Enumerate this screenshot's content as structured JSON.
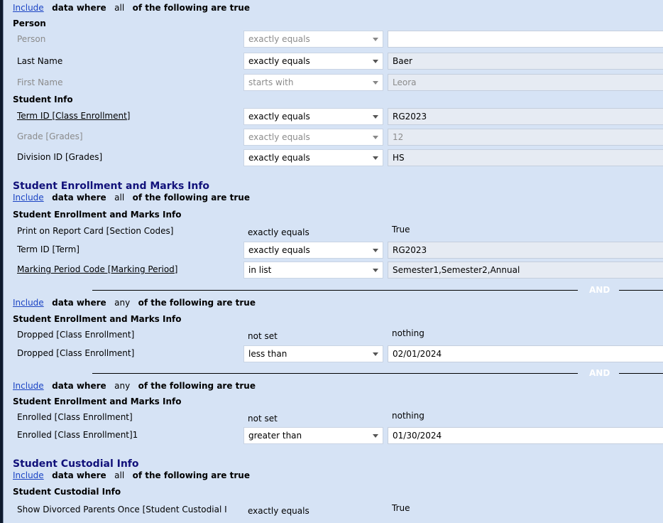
{
  "include_link": "Include",
  "data_where": "data where",
  "following_true": "of the following are true",
  "and_label": "AND",
  "block1": {
    "mode": "all",
    "person_header": "Person",
    "person_rows": [
      {
        "field": "Person",
        "operator": "exactly equals",
        "value": ""
      },
      {
        "field": "Last Name",
        "operator": "exactly equals",
        "value": "Baer"
      },
      {
        "field": "First Name",
        "operator": "starts with",
        "value": "Leora"
      }
    ],
    "student_header": "Student Info",
    "student_rows": [
      {
        "field": "Term ID [Class Enrollment]",
        "operator": "exactly equals",
        "value": "RG2023"
      },
      {
        "field": "Grade  [Grades]",
        "operator": "exactly equals",
        "value": "12"
      },
      {
        "field": "Division ID [Grades]",
        "operator": "exactly equals",
        "value": "HS"
      }
    ]
  },
  "section2": {
    "title": "Student Enrollment and Marks Info",
    "mode": "all",
    "header": "Student Enrollment and Marks Info",
    "rows": [
      {
        "field": "Print on Report Card [Section Codes]",
        "operator": "exactly equals",
        "value": "True"
      },
      {
        "field": "Term ID [Term]",
        "operator": "exactly equals",
        "value": "RG2023"
      },
      {
        "field": "Marking Period Code [Marking Period]",
        "operator": "in list",
        "value": "Semester1,Semester2,Annual"
      }
    ]
  },
  "group_dropped": {
    "mode": "any",
    "header": "Student Enrollment and Marks Info",
    "rows": [
      {
        "field": "Dropped [Class Enrollment]",
        "operator": "not set",
        "value": "nothing"
      },
      {
        "field": "Dropped [Class Enrollment]",
        "operator": "less than",
        "value": "02/01/2024"
      }
    ]
  },
  "group_enrolled": {
    "mode": "any",
    "header": "Student Enrollment and Marks Info",
    "rows": [
      {
        "field": "Enrolled [Class Enrollment]",
        "operator": "not set",
        "value": "nothing"
      },
      {
        "field": "Enrolled [Class Enrollment]1",
        "operator": "greater than",
        "value": "01/30/2024"
      }
    ]
  },
  "section3": {
    "title": "Student Custodial Info",
    "mode": "all",
    "header": "Student Custodial Info",
    "rows": [
      {
        "field": "Show Divorced Parents Once [Student Custodial I",
        "operator": "exactly equals",
        "value": "True"
      }
    ]
  }
}
